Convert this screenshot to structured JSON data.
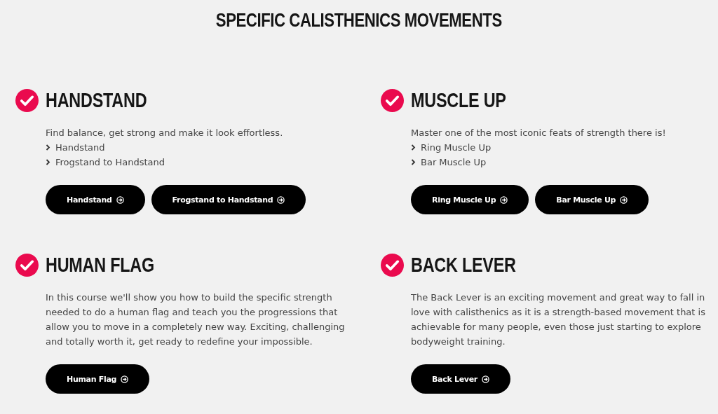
{
  "heading": "SPECIFIC CALISTHENICS MOVEMENTS",
  "movements": [
    {
      "title": "HANDSTAND",
      "checked": true,
      "description": "Find balance, get strong and make it look effortless.",
      "items": [
        "Handstand",
        "Frogstand to Handstand"
      ],
      "buttons": [
        "Handstand",
        "Frogstand to Handstand"
      ]
    },
    {
      "title": "MUSCLE UP",
      "checked": true,
      "description": "Master one of the most iconic feats of strength there is!",
      "items": [
        "Ring Muscle Up",
        "Bar Muscle Up"
      ],
      "buttons": [
        "Ring Muscle Up",
        "Bar Muscle Up"
      ]
    },
    {
      "title": "HUMAN FLAG",
      "checked": true,
      "description": "In this course we'll show you how to build the specific strength needed to do a human flag and teach you the progressions that allow you to move in a completely new way. Exciting, challenging and totally worth it, get ready to redefine your impossible.",
      "buttons": [
        "Human Flag"
      ]
    },
    {
      "title": "BACK LEVER",
      "checked": true,
      "description": "The Back Lever is an exciting movement and great way to fall in love with calisthenics as it is a strength-based movement that is achievable for many people, even those just starting to explore bodyweight training.",
      "buttons": [
        "Back Lever"
      ]
    }
  ]
}
